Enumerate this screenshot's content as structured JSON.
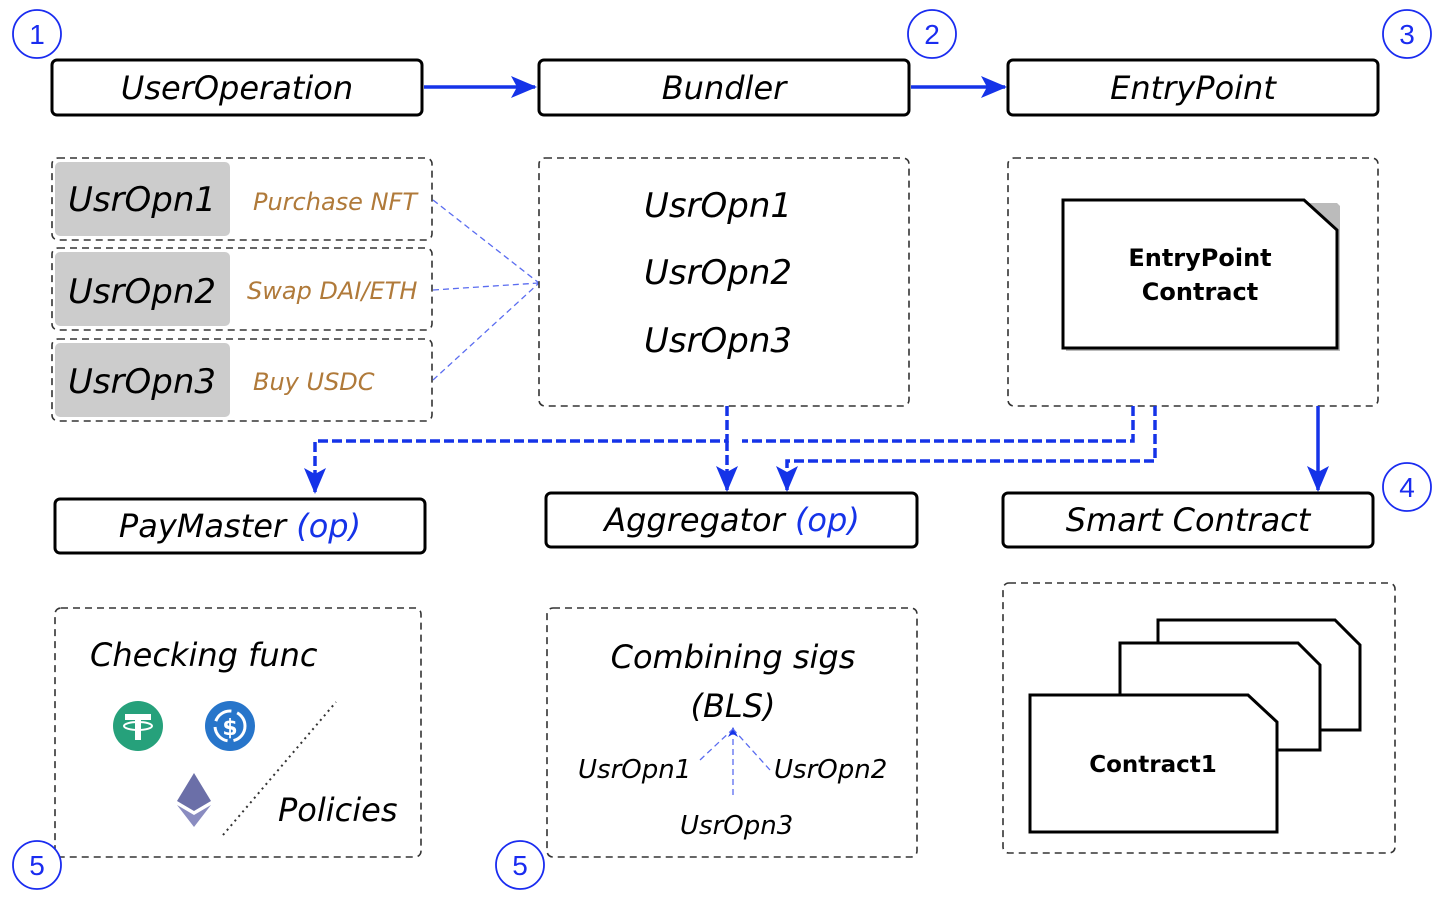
{
  "colors": {
    "accent": "#1533e8",
    "task_label": "#b07a3a",
    "grey_fill": "#cccccc"
  },
  "steps": [
    "1",
    "2",
    "3",
    "4",
    "5",
    "5"
  ],
  "headers": {
    "user_operation": "UserOperation",
    "bundler": "Bundler",
    "entrypoint": "EntryPoint",
    "paymaster": "PayMaster",
    "aggregator": "Aggregator",
    "smart_contract": "Smart Contract",
    "op_tag": "(op)"
  },
  "user_ops": [
    {
      "name": "UsrOpn1",
      "task": "Purchase NFT"
    },
    {
      "name": "UsrOpn2",
      "task": "Swap DAI/ETH"
    },
    {
      "name": "UsrOpn3",
      "task": "Buy USDC"
    }
  ],
  "bundle": [
    "UsrOpn1",
    "UsrOpn2",
    "UsrOpn3"
  ],
  "entrypoint_contract": [
    "EntryPoint",
    "Contract"
  ],
  "paymaster_panel": {
    "title": "Checking func",
    "policies": "Policies",
    "icons": [
      "tether-icon",
      "usdc-icon",
      "ethereum-icon"
    ]
  },
  "aggregator_panel": {
    "title1": "Combining sigs",
    "title2": "(BLS)",
    "ops": [
      "UsrOpn1",
      "UsrOpn2",
      "UsrOpn3"
    ]
  },
  "contract_label": "Contract1"
}
